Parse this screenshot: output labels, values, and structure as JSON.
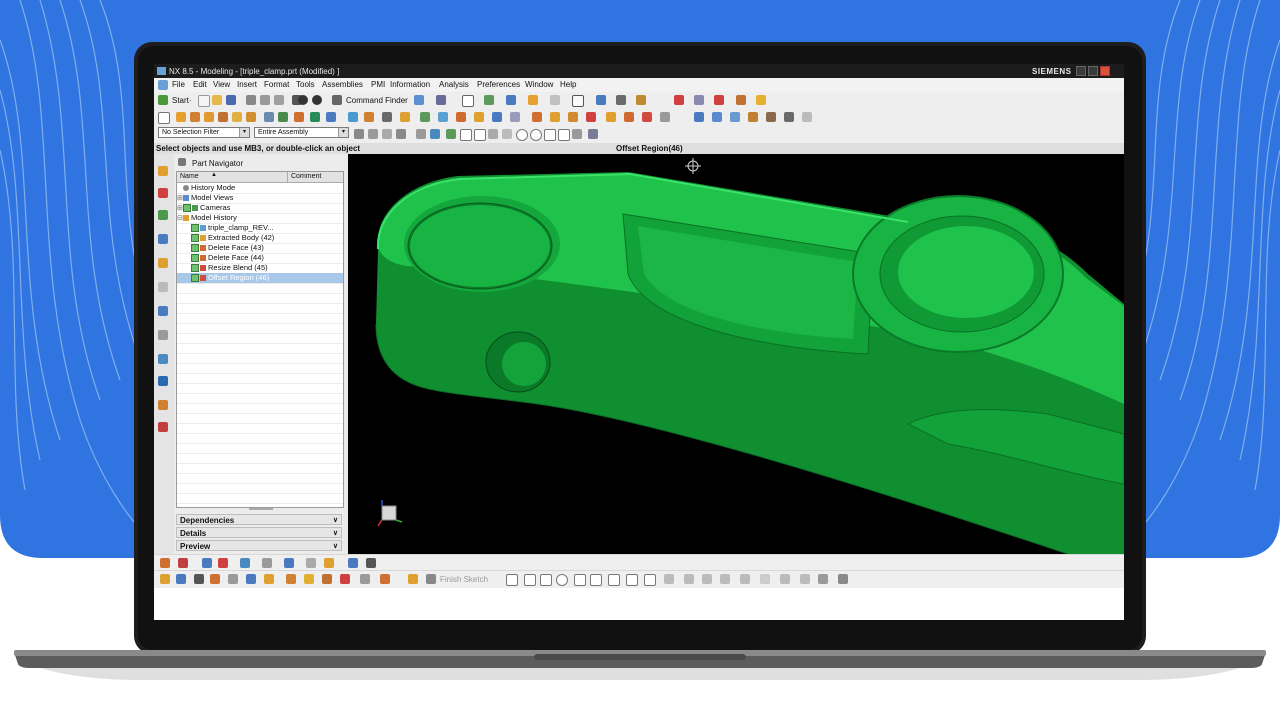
{
  "window": {
    "title": "NX 8.5 - Modeling - [triple_clamp.prt (Modified) ]",
    "brand": "SIEMENS"
  },
  "menu": [
    "File",
    "Edit",
    "View",
    "Insert",
    "Format",
    "Tools",
    "Assemblies",
    "PMI",
    "Information",
    "Analysis",
    "Preferences",
    "Window",
    "Help"
  ],
  "toolbar": {
    "start_label": "Start·",
    "command_finder_label": "Command Finder"
  },
  "filters": {
    "selection_filter": "No Selection Filter",
    "assembly_scope": "Entire Assembly"
  },
  "status": {
    "prompt": "Select objects and use MB3, or double-click an object",
    "current_feature": "Offset Region(46)"
  },
  "part_navigator": {
    "title": "Part Navigator",
    "columns": [
      "Name",
      "Comment"
    ],
    "rows": [
      {
        "label": "History Mode",
        "level": 0,
        "checked": false,
        "selected": false
      },
      {
        "label": "Model Views",
        "level": 0,
        "checked": false,
        "selected": false
      },
      {
        "label": "Cameras",
        "level": 0,
        "checked": true,
        "selected": false
      },
      {
        "label": "Model History",
        "level": 0,
        "checked": false,
        "selected": false
      },
      {
        "label": "triple_clamp_REV...",
        "level": 1,
        "checked": true,
        "selected": false
      },
      {
        "label": "Extracted Body (42)",
        "level": 1,
        "checked": true,
        "selected": false
      },
      {
        "label": "Delete Face (43)",
        "level": 1,
        "checked": true,
        "selected": false
      },
      {
        "label": "Delete Face (44)",
        "level": 1,
        "checked": true,
        "selected": false
      },
      {
        "label": "Resize Blend (45)",
        "level": 1,
        "checked": true,
        "selected": false
      },
      {
        "label": "Offset Region (46)",
        "level": 1,
        "checked": true,
        "selected": true
      }
    ],
    "sections": [
      "Dependencies",
      "Details",
      "Preview"
    ]
  },
  "sketch_toolbar": {
    "finish_sketch_label": "Finish Sketch"
  },
  "colors": {
    "model_green": "#1fc24a",
    "model_edge": "#0a7a26",
    "background_blue": "#2f74e0",
    "viewport_bg": "#000000",
    "selection_blue": "#a8c8ea"
  },
  "icons": [
    "siemens-nx-logo",
    "start-icon",
    "new-icon",
    "open-icon",
    "save-icon",
    "cut-icon",
    "copy-icon",
    "paste-icon",
    "undo-icon",
    "redo-icon",
    "command-finder-icon",
    "wcs-icon",
    "view-triad-icon",
    "line-icon",
    "arc-icon",
    "circle-icon",
    "rectangle-icon",
    "point-icon",
    "dropdown-arrow-icon"
  ]
}
